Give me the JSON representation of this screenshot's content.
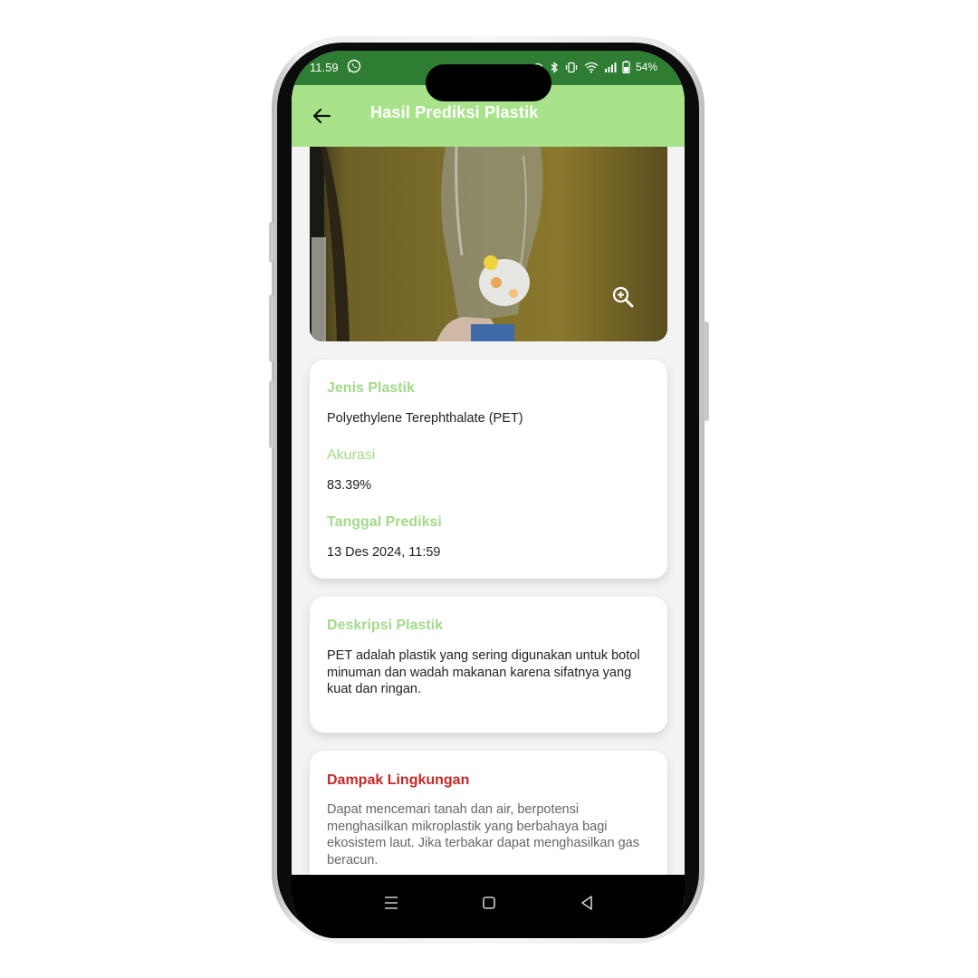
{
  "status_bar": {
    "time": "11.59",
    "battery": "54%"
  },
  "app_bar": {
    "title": "Hasil Prediksi Plastik"
  },
  "info_card": {
    "type_label": "Jenis Plastik",
    "type_value": "Polyethylene Terephthalate (PET)",
    "accuracy_label": "Akurasi",
    "accuracy_value": "83.39%",
    "date_label": "Tanggal Prediksi",
    "date_value": "13 Des 2024, 11:59"
  },
  "description_card": {
    "label": "Deskripsi Plastik",
    "text": "PET adalah plastik yang sering digunakan untuk botol minuman dan wadah makanan karena sifatnya yang kuat dan ringan."
  },
  "impact_card": {
    "label": "Dampak Lingkungan",
    "text": "Dapat mencemari tanah dan air, berpotensi menghasilkan mikroplastik yang berbahaya bagi ekosistem laut. Jika terbakar dapat menghasilkan gas beracun."
  },
  "icons": {
    "back": "arrow-left-icon",
    "zoom": "zoom-in-icon",
    "nav_menu": "menu-icon",
    "nav_home": "home-square-icon",
    "nav_back": "back-triangle-icon"
  },
  "colors": {
    "status_bar": "#2e7d32",
    "app_bar": "#a8e38b",
    "label_green": "#a3da8b",
    "label_red": "#c62828",
    "background": "#f3f3f3"
  }
}
